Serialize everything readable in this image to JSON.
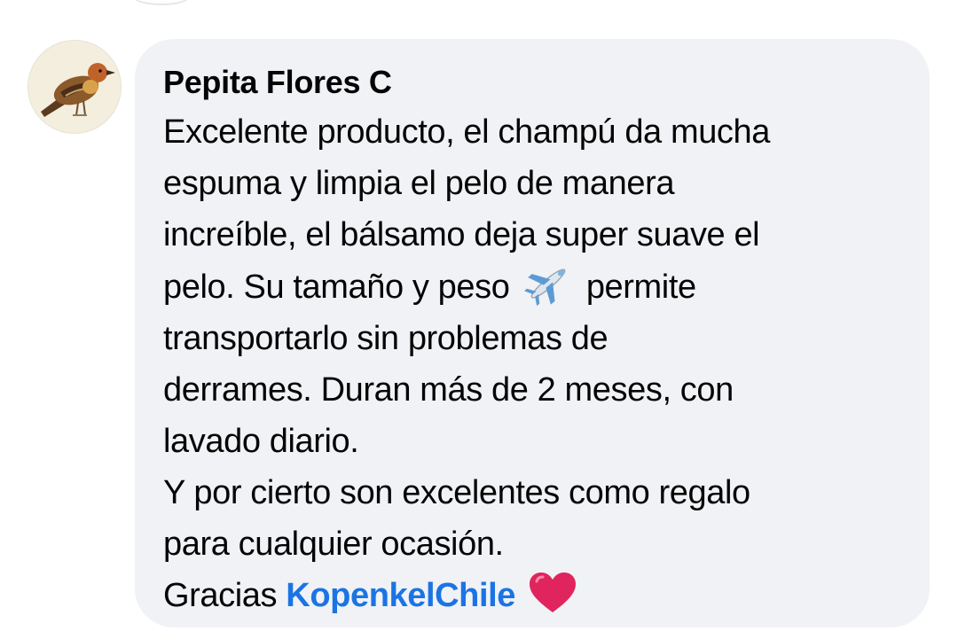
{
  "comment": {
    "author": "Pepita Flores C",
    "lines": [
      "Excelente producto, el champú da mucha",
      "espuma y limpia el pelo de manera",
      "increíble, el bálsamo deja super suave el"
    ],
    "line4_before": "pelo. Su tamaño y peso",
    "line4_after": "permite",
    "lines_rest": [
      "transportarlo sin problemas de",
      "derrames. Duran más de 2 meses, con",
      "lavado diario.",
      "Y por cierto son excelentes como regalo",
      "para cualquier ocasión."
    ],
    "closing_text": "Gracias",
    "mention": "KopenkelChile",
    "emoji_airplane": "airplane-emoji",
    "emoji_heart": "red-heart-emoji"
  },
  "colors": {
    "bubble_bg": "#f0f2f5",
    "mention": "#1b74e4",
    "heart": "#e0245e"
  }
}
